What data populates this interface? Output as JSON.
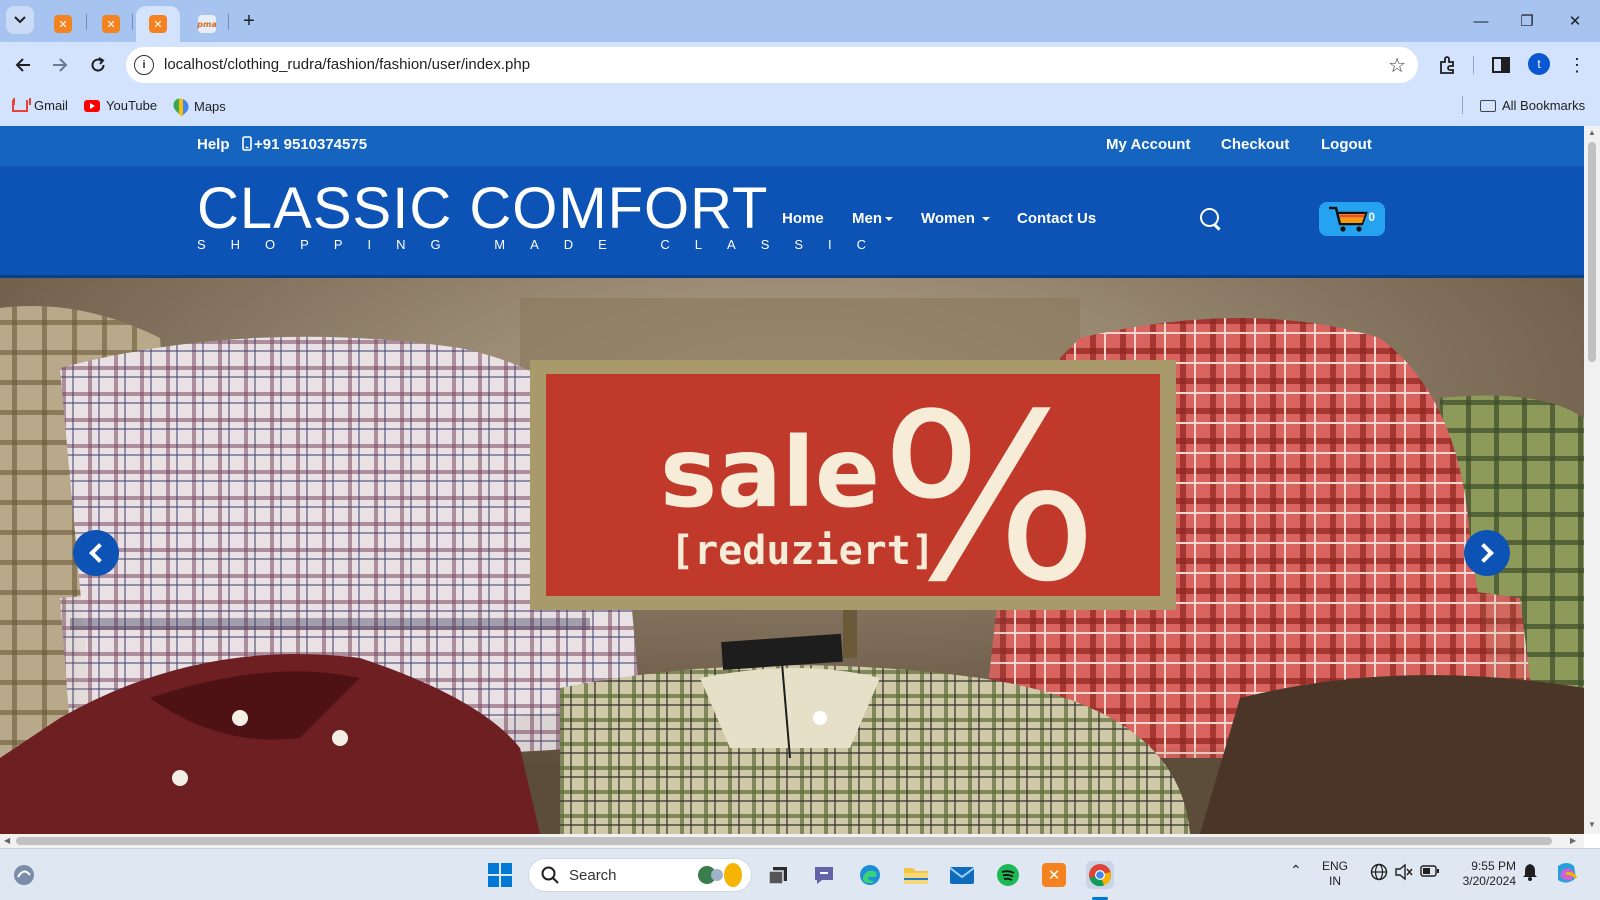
{
  "browser": {
    "tabs": [
      {
        "favicon": "xampp-icon",
        "active": false
      },
      {
        "favicon": "xampp-icon",
        "active": false
      },
      {
        "favicon": "xampp-icon",
        "active": true
      },
      {
        "favicon": "phpmyadmin-icon",
        "active": false,
        "favicon_text": "pma"
      }
    ],
    "url": "localhost/clothing_rudra/fashion/fashion/user/index.php",
    "profile_initial": "t",
    "bookmarks": [
      {
        "label": "Gmail",
        "icon": "gmail-icon"
      },
      {
        "label": "YouTube",
        "icon": "youtube-icon"
      },
      {
        "label": "Maps",
        "icon": "maps-icon"
      }
    ],
    "all_bookmarks_label": "All Bookmarks"
  },
  "site": {
    "topbar": {
      "help": "Help",
      "phone": "+91 9510374575",
      "links": [
        "My Account",
        "Checkout",
        "Logout"
      ]
    },
    "logo": {
      "title": "CLASSIC COMFORT",
      "tagline": "SHOPPING MADE CLASSIC"
    },
    "nav": [
      {
        "label": "Home",
        "dropdown": false
      },
      {
        "label": "Men",
        "dropdown": true
      },
      {
        "label": "Women",
        "dropdown": true
      },
      {
        "label": "Contact Us",
        "dropdown": false
      }
    ],
    "cart_count": "0",
    "hero": {
      "sign_text": "sale",
      "sign_subtext": "[reduziert]",
      "sign_symbol": "%"
    },
    "colors": {
      "topbar": "#1565c0",
      "header": "#0d52b5",
      "cart": "#26a3f0",
      "sale_sign": "#c0392b"
    }
  },
  "taskbar": {
    "search_label": "Search",
    "language": "ENG",
    "region": "IN",
    "time": "9:55 PM",
    "date": "3/20/2024"
  }
}
